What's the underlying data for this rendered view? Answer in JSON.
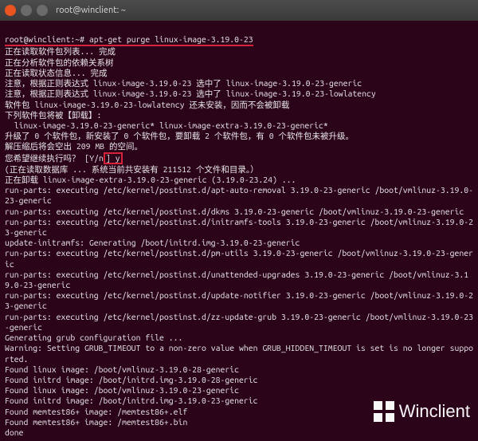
{
  "window": {
    "title": "root@winclient: ~"
  },
  "prompt": {
    "user_host": "root@winclient:~#",
    "command": "apt-get purge linux-image-3.19.0-23"
  },
  "lines": {
    "l01": "正在读取软件包列表... 完成",
    "l02": "正在分析软件包的依赖关系树",
    "l03": "正在读取状态信息... 完成",
    "l04": "注意，根据正则表达式 linux-image-3.19.0-23 选中了 linux-image-3.19.0-23-generic",
    "l05": "注意，根据正则表达式 linux-image-3.19.0-23 选中了 linux-image-3.19.0-23-lowlatency",
    "l06": "软件包 linux-image-3.19.0-23-lowlatency 还未安装，因而不会被卸载",
    "l07": "下列软件包将被【卸载】:",
    "l08": "  linux-image-3.19.0-23-generic* linux-image-extra-3.19.0-23-generic*",
    "l09": "升级了 0 个软件包，新安装了 0 个软件包，要卸载 2 个软件包，有 0 个软件包未被升级。",
    "l10": "解压缩后将会空出 209 MB 的空间。",
    "l11a": "您希望继续执行吗？ [Y/n",
    "l11b": "] y",
    "l12": "(正在读取数据库 ... 系统当前共安装有 211512 个文件和目录。）",
    "l13": "正在卸载 linux-image-extra-3.19.0-23-generic (3.19.0-23.24) ...",
    "l14": "run-parts: executing /etc/kernel/postinst.d/apt-auto-removal 3.19.0-23-generic /boot/vmlinuz-3.19.0-23-generic",
    "l15": "run-parts: executing /etc/kernel/postinst.d/dkms 3.19.0-23-generic /boot/vmlinuz-3.19.0-23-generic",
    "l16": "run-parts: executing /etc/kernel/postinst.d/initramfs-tools 3.19.0-23-generic /boot/vmlinuz-3.19.0-23-generic",
    "l17": "update-initramfs: Generating /boot/initrd.img-3.19.0-23-generic",
    "l18": "run-parts: executing /etc/kernel/postinst.d/pm-utils 3.19.0-23-generic /boot/vmlinuz-3.19.0-23-generic",
    "l19": "run-parts: executing /etc/kernel/postinst.d/unattended-upgrades 3.19.0-23-generic /boot/vmlinuz-3.19.0-23-generic",
    "l20": "run-parts: executing /etc/kernel/postinst.d/update-notifier 3.19.0-23-generic /boot/vmlinuz-3.19.0-23-generic",
    "l21": "run-parts: executing /etc/kernel/postinst.d/zz-update-grub 3.19.0-23-generic /boot/vmlinuz-3.19.0-23-generic",
    "l22": "Generating grub configuration file ...",
    "l23": "Warning: Setting GRUB_TIMEOUT to a non-zero value when GRUB_HIDDEN_TIMEOUT is set is no longer supported.",
    "l24": "Found linux image: /boot/vmlinuz-3.19.0-28-generic",
    "l25": "Found initrd image: /boot/initrd.img-3.19.0-28-generic",
    "l26": "Found linux image: /boot/vmlinuz-3.19.0-23-generic",
    "l27": "Found initrd image: /boot/initrd.img-3.19.0-23-generic",
    "l28": "Found memtest86+ image: /memtest86+.elf",
    "l29": "Found memtest86+ image: /memtest86+.bin",
    "l30": "done"
  },
  "watermark": {
    "text": "Winclient"
  }
}
